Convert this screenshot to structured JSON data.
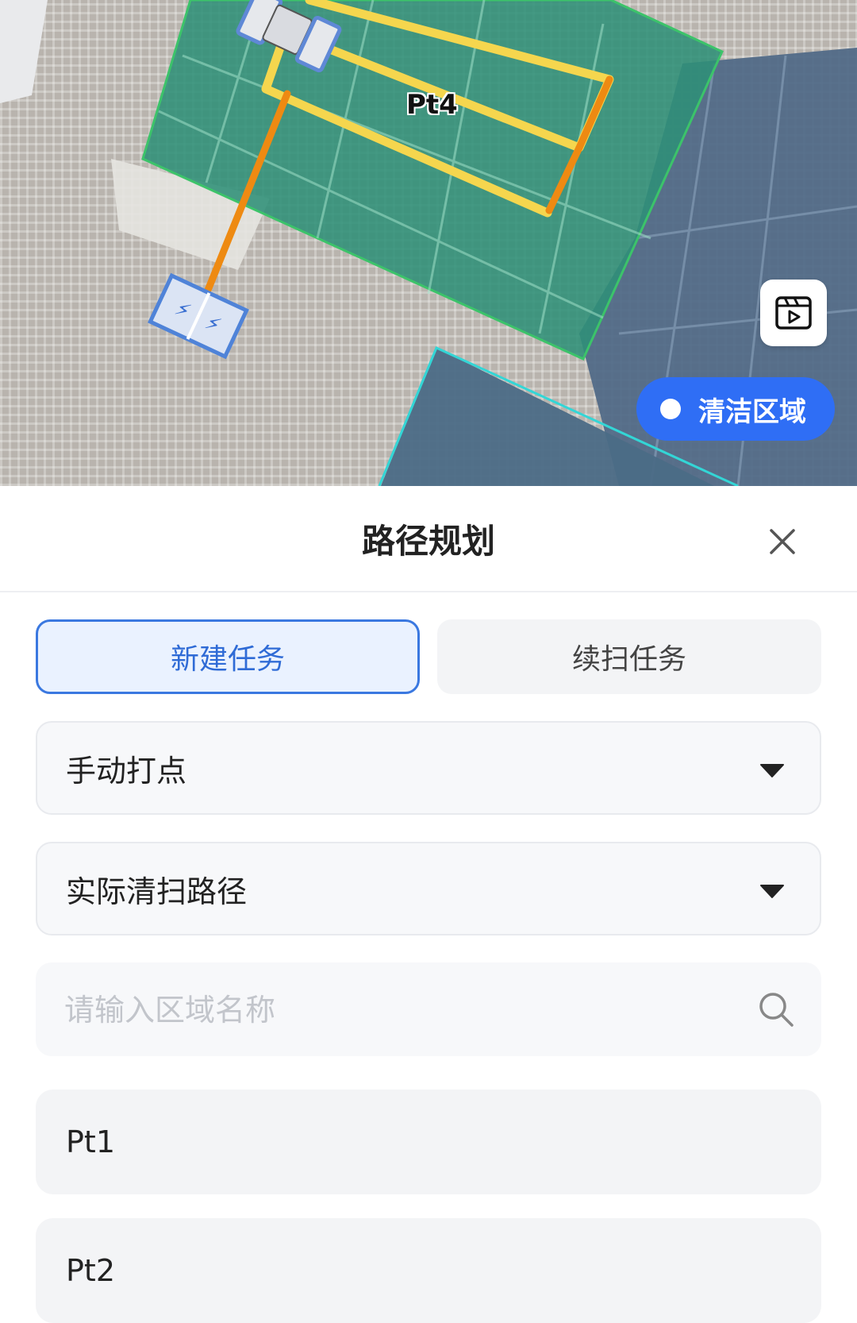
{
  "map": {
    "region_label": "Pt4",
    "video_icon": "video-play-icon",
    "area_toggle_label": "清洁区域",
    "colors": {
      "region_fill": "#2f8f78",
      "region_border": "#3cc36a",
      "path_yellow": "#f5d64e",
      "path_orange": "#ee8a12",
      "panel_blue": "#4c6a88",
      "cyan_border": "#33d6d6"
    }
  },
  "sheet": {
    "title": "路径规划",
    "close_icon": "close-icon",
    "tabs": [
      {
        "label": "新建任务",
        "active": true
      },
      {
        "label": "续扫任务",
        "active": false
      }
    ],
    "mode_select": {
      "value": "手动打点",
      "icon": "caret-down-icon"
    },
    "path_select": {
      "value": "实际清扫路径",
      "icon": "caret-down-icon"
    },
    "search": {
      "placeholder": "请输入区域名称",
      "value": "",
      "icon": "search-icon"
    },
    "list": [
      {
        "label": "Pt1"
      },
      {
        "label": "Pt2"
      }
    ]
  }
}
